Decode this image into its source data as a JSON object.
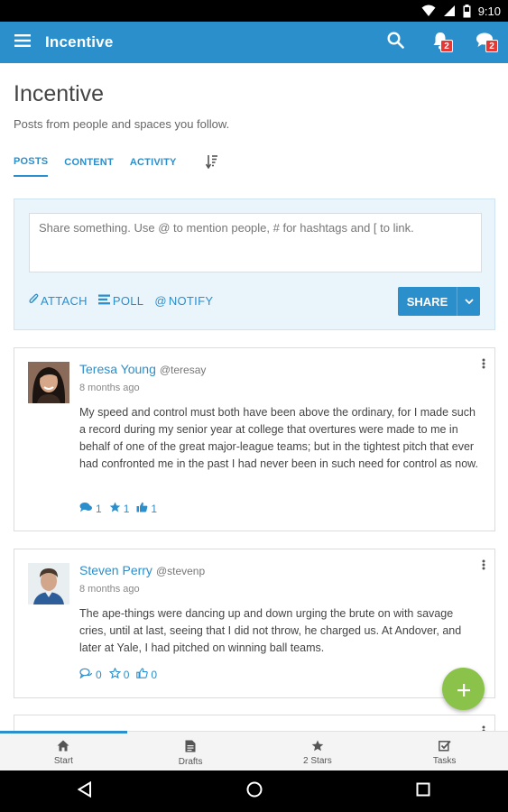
{
  "status_bar": {
    "time": "9:10"
  },
  "app_bar": {
    "title": "Incentive",
    "notifications_count": "2",
    "messages_count": "2"
  },
  "page": {
    "title": "Incentive",
    "subtitle": "Posts from people and spaces you follow."
  },
  "tabs": [
    {
      "label": "POSTS",
      "active": true
    },
    {
      "label": "CONTENT",
      "active": false
    },
    {
      "label": "ACTIVITY",
      "active": false
    }
  ],
  "composer": {
    "placeholder": "Share something. Use @ to mention people, # for hashtags and [ to link.",
    "attach_label": "ATTACH",
    "poll_label": "POLL",
    "notify_label": "NOTIFY",
    "share_label": "SHARE"
  },
  "posts": [
    {
      "name": "Teresa Young",
      "handle": "@teresay",
      "time": "8 months ago",
      "body": "My speed and control must both have been above the ordinary, for I made such a record during my senior year at college that overtures were made to me in behalf of one of the great major-league teams; but in the tightest pitch that ever had confronted me in the past I had never been in such need for control as now.",
      "comments": "1",
      "stars": "1",
      "likes": "1"
    },
    {
      "name": "Steven Perry",
      "handle": "@stevenp",
      "time": "8 months ago",
      "body": "The ape-things were dancing up and down urging the brute on with savage cries, until at last, seeing that I did not throw, he charged us. At Andover, and later at Yale, I had pitched on winning ball teams.",
      "comments": "0",
      "stars": "0",
      "likes": "0"
    }
  ],
  "bottom_nav": [
    {
      "label": "Start",
      "icon": "home-icon"
    },
    {
      "label": "Drafts",
      "icon": "document-icon"
    },
    {
      "label": "2 Stars",
      "icon": "star-icon"
    },
    {
      "label": "Tasks",
      "icon": "checkbox-icon"
    }
  ],
  "colors": {
    "primary": "#2b8fcc",
    "fab": "#8bc34a",
    "badge": "#e53935"
  }
}
